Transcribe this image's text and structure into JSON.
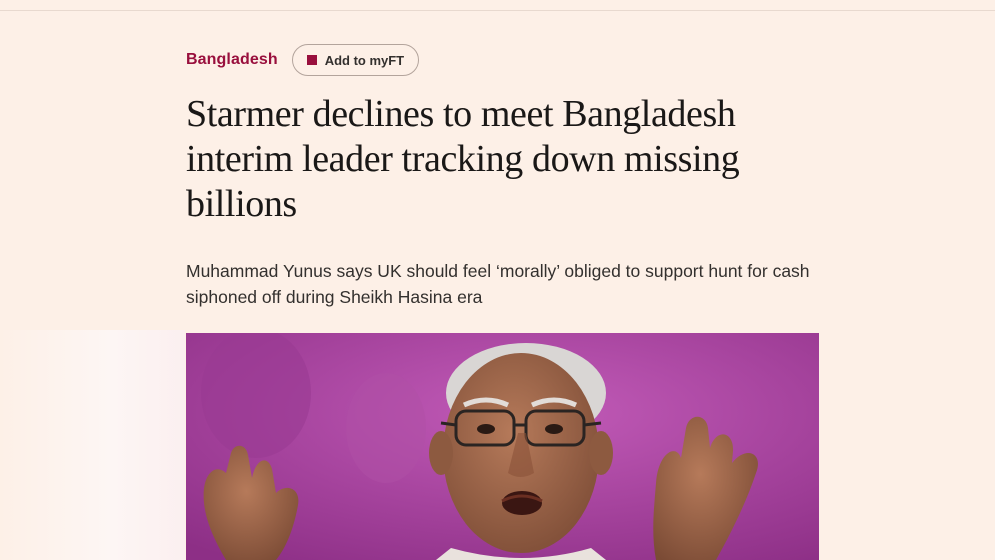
{
  "article": {
    "topic": "Bangladesh",
    "myft_label": "Add to myFT",
    "headline": "Starmer declines to meet Bangladesh interim leader tracking down missing billions",
    "standfirst": "Muhammad Yunus says UK should feel ‘morally’ obliged to support hunt for cash siphoned off during Sheikh Hasina era"
  },
  "colors": {
    "background": "#fdf0e7",
    "brand_claret": "#990f3d",
    "headline_text": "#1a1817",
    "photo_backdrop": "#a8449f"
  },
  "icons": {
    "myft": "square-bookmark-icon"
  }
}
